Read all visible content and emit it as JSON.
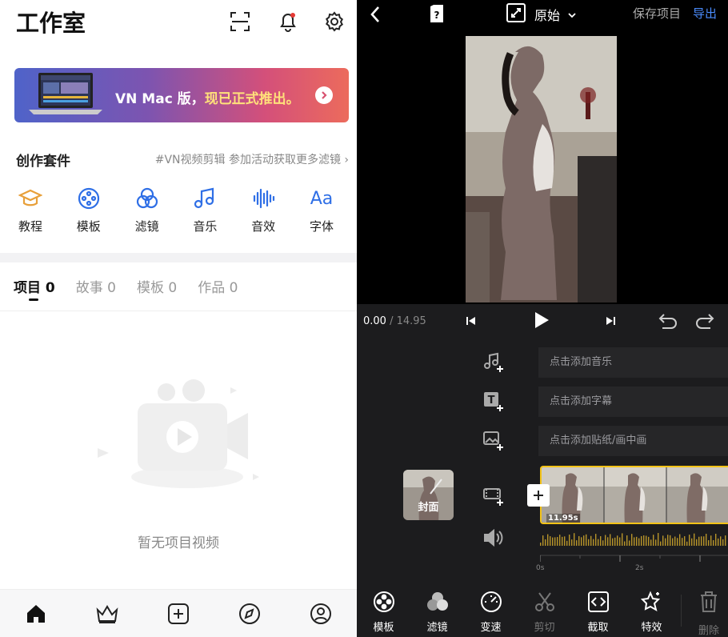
{
  "studio": {
    "title": "工作室",
    "banner": {
      "prefix": "VN Mac 版，",
      "highlight": "现已正式推出。"
    },
    "suite": {
      "title": "创作套件",
      "link": "#VN视频剪辑 参加活动获取更多滤镜 ›",
      "items": [
        {
          "label": "教程",
          "icon": "graduation-cap-icon"
        },
        {
          "label": "模板",
          "icon": "film-reel-icon"
        },
        {
          "label": "滤镜",
          "icon": "filter-circles-icon"
        },
        {
          "label": "音乐",
          "icon": "music-note-icon"
        },
        {
          "label": "音效",
          "icon": "sound-wave-icon"
        },
        {
          "label": "字体",
          "icon": "font-aa-icon"
        }
      ]
    },
    "tabs": [
      {
        "label": "项目 0",
        "active": true
      },
      {
        "label": "故事 0",
        "active": false
      },
      {
        "label": "模板 0",
        "active": false
      },
      {
        "label": "作品 0",
        "active": false
      }
    ],
    "empty_text": "暂无项目视频",
    "bottom_nav": [
      "home-icon",
      "crown-icon",
      "add-square-icon",
      "compass-icon",
      "profile-icon"
    ]
  },
  "editor": {
    "top_bar": {
      "ratio_label": "原始",
      "save_label": "保存项目",
      "export_label": "导出"
    },
    "time": {
      "current": "0.00",
      "total": " / 14.95"
    },
    "tracks": {
      "music": "点击添加音乐",
      "subtitle": "点击添加字幕",
      "sticker": "点击添加贴纸/画中画"
    },
    "cover_label": "封面",
    "clip_duration": "11.95s",
    "ruler": [
      "0s",
      "2s"
    ],
    "tools": [
      {
        "label": "模板",
        "icon": "template-reel-icon",
        "enabled": true
      },
      {
        "label": "滤镜",
        "icon": "filter-icon",
        "enabled": true
      },
      {
        "label": "变速",
        "icon": "speedometer-icon",
        "enabled": true
      },
      {
        "label": "剪切",
        "icon": "scissors-icon",
        "enabled": false
      },
      {
        "label": "截取",
        "icon": "trim-icon",
        "enabled": true
      },
      {
        "label": "特效",
        "icon": "effects-star-icon",
        "enabled": true
      }
    ],
    "delete_label": "删除",
    "colors": {
      "accent_export": "#4b8dff",
      "clip_border": "#f3c318",
      "studio_icon": "#2f6fe6"
    }
  }
}
